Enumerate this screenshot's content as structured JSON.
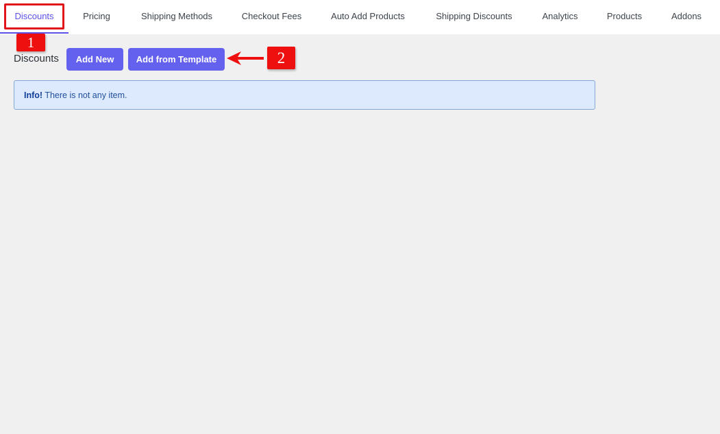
{
  "tabs": [
    {
      "label": "Discounts",
      "active": true
    },
    {
      "label": "Pricing"
    },
    {
      "label": "Shipping Methods"
    },
    {
      "label": "Checkout Fees"
    },
    {
      "label": "Auto Add Products"
    },
    {
      "label": "Shipping Discounts"
    },
    {
      "label": "Analytics"
    },
    {
      "label": "Products"
    },
    {
      "label": "Addons"
    }
  ],
  "header": {
    "title": "Discounts",
    "add_new_label": "Add New",
    "add_template_label": "Add from Template"
  },
  "notice": {
    "strong": "Info!",
    "message": "There is not any item."
  },
  "annotations": {
    "step1": "1",
    "step2": "2"
  },
  "colors": {
    "accent": "#6461ee",
    "annotation_red": "#ee0f0f",
    "notice_bg": "#dde9fd",
    "page_bg": "#f0f0f1"
  }
}
